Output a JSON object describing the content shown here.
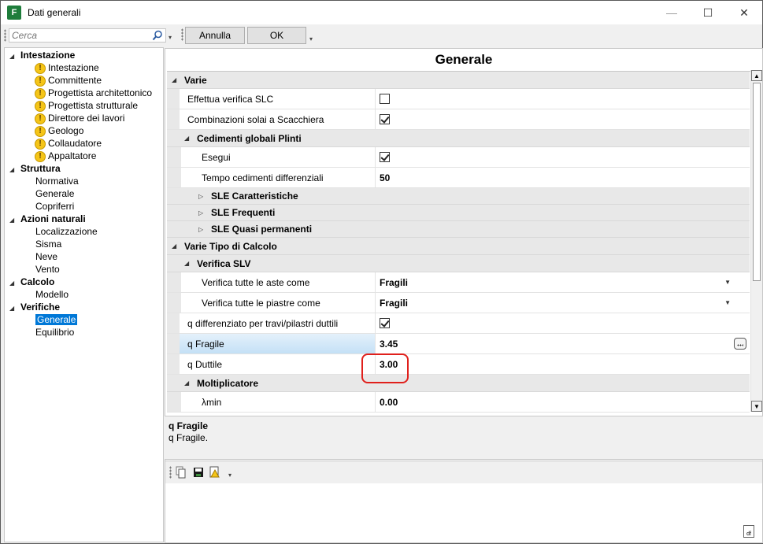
{
  "window": {
    "title": "Dati generali",
    "app_icon_letter": "F",
    "app_icon_sub": "",
    "minimize": "—",
    "maximize": "☐",
    "close": "✕"
  },
  "search": {
    "placeholder": "Cerca"
  },
  "toolbar": {
    "cancel_label": "Annulla",
    "ok_label": "OK"
  },
  "tree": [
    {
      "label": "Intestazione",
      "level": 0,
      "expanded": true
    },
    {
      "label": "Intestazione",
      "level": 1,
      "warn": true
    },
    {
      "label": "Committente",
      "level": 1,
      "warn": true
    },
    {
      "label": "Progettista architettonico",
      "level": 1,
      "warn": true
    },
    {
      "label": "Progettista strutturale",
      "level": 1,
      "warn": true
    },
    {
      "label": "Direttore dei lavori",
      "level": 1,
      "warn": true
    },
    {
      "label": "Geologo",
      "level": 1,
      "warn": true
    },
    {
      "label": "Collaudatore",
      "level": 1,
      "warn": true
    },
    {
      "label": "Appaltatore",
      "level": 1,
      "warn": true
    },
    {
      "label": "Struttura",
      "level": 0,
      "expanded": true
    },
    {
      "label": "Normativa",
      "level": 1
    },
    {
      "label": "Generale",
      "level": 1
    },
    {
      "label": "Copriferri",
      "level": 1
    },
    {
      "label": "Azioni naturali",
      "level": 0,
      "expanded": true
    },
    {
      "label": "Localizzazione",
      "level": 1
    },
    {
      "label": "Sisma",
      "level": 1
    },
    {
      "label": "Neve",
      "level": 1
    },
    {
      "label": "Vento",
      "level": 1
    },
    {
      "label": "Calcolo",
      "level": 0,
      "expanded": true
    },
    {
      "label": "Modello",
      "level": 1
    },
    {
      "label": "Verifiche",
      "level": 0,
      "expanded": true
    },
    {
      "label": "Generale",
      "level": 1,
      "selected": true
    },
    {
      "label": "Equilibrio",
      "level": 1
    }
  ],
  "main": {
    "title": "Generale",
    "grid": [
      {
        "type": "cat",
        "label": "Varie",
        "depth": 0,
        "expanded": true
      },
      {
        "type": "check",
        "label": "Effettua verifica SLC",
        "depth": 0,
        "checked": false
      },
      {
        "type": "check",
        "label": "Combinazioni solai a Scacchiera",
        "depth": 0,
        "checked": true
      },
      {
        "type": "cat",
        "label": "Cedimenti globali Plinti",
        "depth": 1,
        "expanded": true
      },
      {
        "type": "check",
        "label": "Esegui",
        "depth": 1,
        "checked": true
      },
      {
        "type": "text",
        "label": "Tempo cedimenti differenziali",
        "depth": 1,
        "value": "50"
      },
      {
        "type": "cat",
        "label": "SLE Caratteristiche",
        "depth": 2,
        "expanded": false
      },
      {
        "type": "cat",
        "label": "SLE Frequenti",
        "depth": 2,
        "expanded": false
      },
      {
        "type": "cat",
        "label": "SLE Quasi permanenti",
        "depth": 2,
        "expanded": false
      },
      {
        "type": "cat",
        "label": "Varie Tipo di Calcolo",
        "depth": 0,
        "expanded": true
      },
      {
        "type": "cat",
        "label": "Verifica SLV",
        "depth": 1,
        "expanded": true
      },
      {
        "type": "dropdown",
        "label": "Verifica tutte le aste come",
        "depth": 1,
        "value": "Fragili"
      },
      {
        "type": "dropdown",
        "label": "Verifica tutte le piastre come",
        "depth": 1,
        "value": "Fragili"
      },
      {
        "type": "check",
        "label": "q differenziato per travi/pilastri duttili",
        "depth": 0,
        "checked": true
      },
      {
        "type": "text",
        "label": "q Fragile",
        "depth": 0,
        "value": "3.45",
        "selected": true,
        "calc": true
      },
      {
        "type": "text",
        "label": "q Duttile",
        "depth": 0,
        "value": "3.00"
      },
      {
        "type": "cat",
        "label": "Moltiplicatore",
        "depth": 1,
        "expanded": true
      },
      {
        "type": "text",
        "label": "λmin",
        "depth": 1,
        "value": "0.00"
      }
    ]
  },
  "description": {
    "title": "q Fragile",
    "text": "q Fragile."
  },
  "icons": {
    "search": "search-icon",
    "warn": "warning-icon",
    "copy": "copy-icon",
    "save": "save-icon",
    "report": "report-warning-icon",
    "status": "document-icon"
  }
}
